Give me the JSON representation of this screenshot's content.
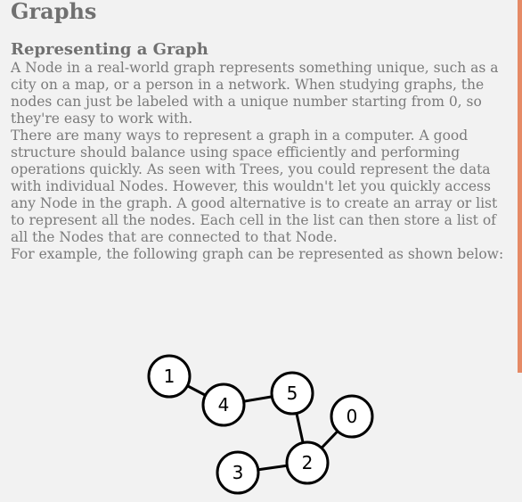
{
  "page": {
    "title": "Graphs",
    "section_title": "Representing a Graph",
    "paragraphs": [
      "A Node in a real-world graph represents something unique, such as a city on a map, or a person in a network. When studying graphs, the nodes can just be labeled with a unique number starting from 0, so they're easy to work with.",
      "There are many ways to represent a graph in a computer. A good structure should balance using space efficiently and performing operations quickly. As seen with Trees, you could represent the data with individual Nodes. However, this wouldn't let you quickly access any Node in the graph. A good alternative is to create an array or list to represent all the nodes. Each cell in the list can then store a list of all the Nodes that are connected to that Node.",
      "For example, the following graph can be represented as shown below:"
    ]
  },
  "graph": {
    "nodes": [
      "1",
      "4",
      "5",
      "0",
      "2",
      "3"
    ],
    "edges": [
      [
        "1",
        "4"
      ],
      [
        "4",
        "5"
      ],
      [
        "5",
        "2"
      ],
      [
        "0",
        "2"
      ],
      [
        "3",
        "2"
      ]
    ]
  },
  "colors": {
    "background": "#f2f2f2",
    "text": "#7a7a7a",
    "scrollbar_accent": "#e58a66"
  }
}
